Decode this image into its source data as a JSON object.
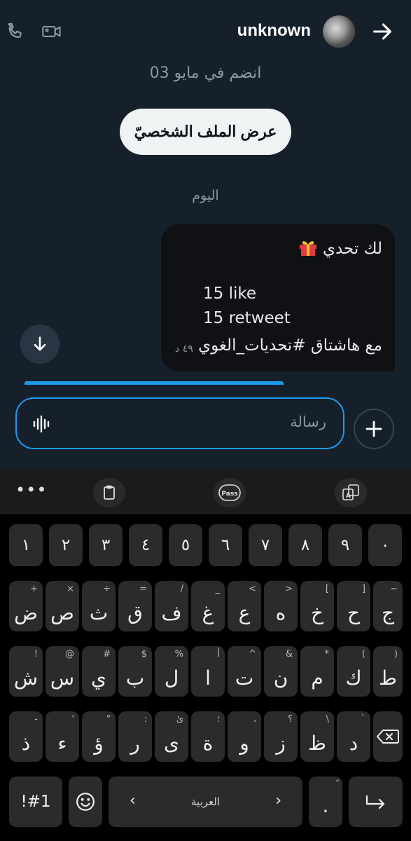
{
  "header": {
    "title": "unknown",
    "icons": [
      "phone-icon",
      "video-icon",
      "back-arrow-icon"
    ]
  },
  "conversation": {
    "joined": "انضم في مايو 03",
    "profile_button": "عرض الملف الشخصيّ",
    "day_label": "اليوم",
    "message": {
      "line1": "لك تحدي",
      "line2": "15 like",
      "line3": "15 retweet",
      "line4": "مع هاشتاق #تحديات_الغوي",
      "time": "٤٩ د",
      "emoji": "gift"
    }
  },
  "composer": {
    "placeholder": "رسالة"
  },
  "keyboard": {
    "toolbar": [
      "more-dots-icon",
      "clipboard-icon",
      "pass-icon",
      "translate-icon"
    ],
    "pass_label": "Pass",
    "numbers": [
      "١",
      "٢",
      "٣",
      "٤",
      "٥",
      "٦",
      "٧",
      "٨",
      "٩",
      "٠"
    ],
    "row1": [
      {
        "m": "ض",
        "s": "+"
      },
      {
        "m": "ص",
        "s": "×"
      },
      {
        "m": "ث",
        "s": "÷"
      },
      {
        "m": "ق",
        "s": "="
      },
      {
        "m": "ف",
        "s": "/"
      },
      {
        "m": "غ",
        "s": "_"
      },
      {
        "m": "ع",
        "s": "<"
      },
      {
        "m": "ه",
        "s": ">"
      },
      {
        "m": "خ",
        "s": "["
      },
      {
        "m": "ح",
        "s": "]"
      },
      {
        "m": "ج",
        "s": "~"
      }
    ],
    "row2": [
      {
        "m": "ش",
        "s": "!"
      },
      {
        "m": "س",
        "s": "@"
      },
      {
        "m": "ي",
        "s": "#"
      },
      {
        "m": "ب",
        "s": "$"
      },
      {
        "m": "ل",
        "s": "%"
      },
      {
        "m": "ا",
        "s": "أ"
      },
      {
        "m": "ت",
        "s": "^"
      },
      {
        "m": "ن",
        "s": "&"
      },
      {
        "m": "م",
        "s": "*"
      },
      {
        "m": "ك",
        "s": "("
      },
      {
        "m": "ط",
        "s": ")"
      }
    ],
    "row3": [
      {
        "m": "ذ",
        "s": "-"
      },
      {
        "m": "ء",
        "s": "'"
      },
      {
        "m": "ؤ",
        "s": "\""
      },
      {
        "m": "ر",
        "s": ":"
      },
      {
        "m": "ى",
        "s": "ئ"
      },
      {
        "m": "ة",
        "s": "؛"
      },
      {
        "m": "و",
        "s": "،"
      },
      {
        "m": "ز",
        "s": "؟"
      },
      {
        "m": "ظ",
        "s": "\\"
      },
      {
        "m": "د",
        "s": "`"
      }
    ],
    "symbols_label": "!#1",
    "space_label": "العربية",
    "period_label": ".",
    "period_sub": "ً"
  }
}
